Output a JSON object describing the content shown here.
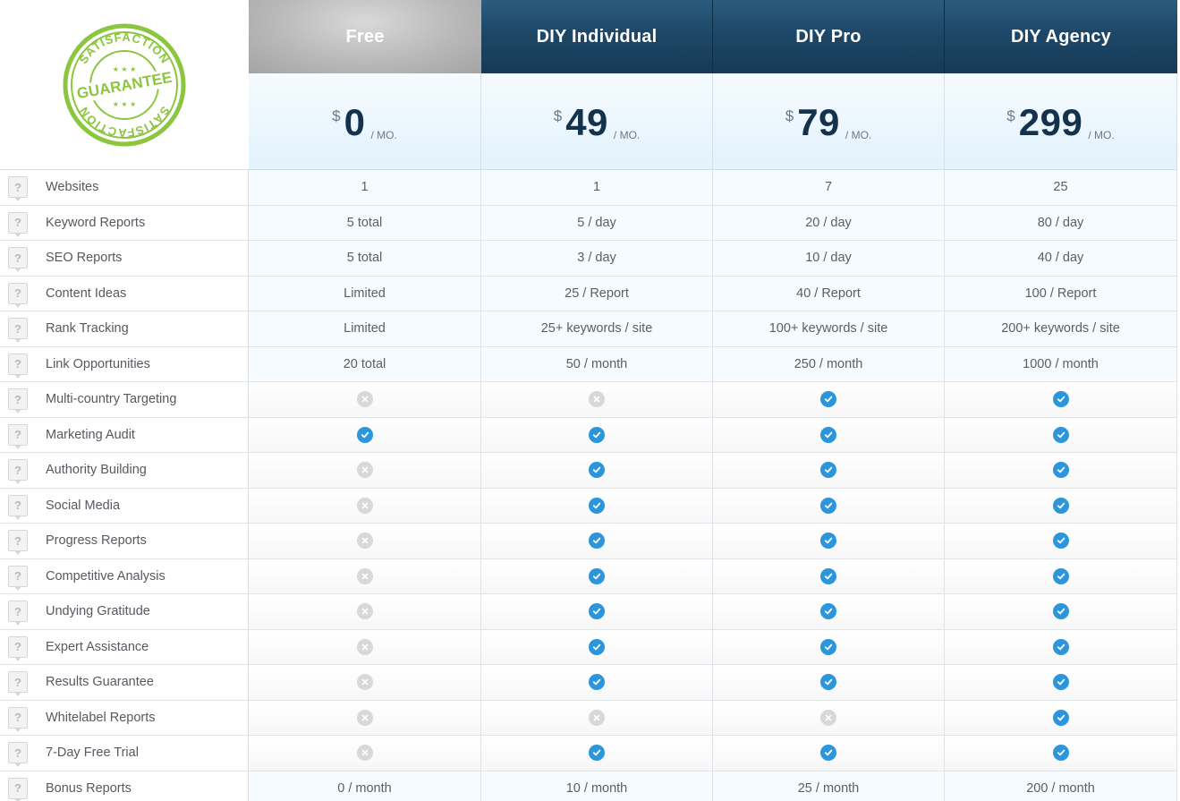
{
  "seal": {
    "top_text": "SATISFACTION",
    "middle_text": "GUARANTEE",
    "bottom_text": "SATISFACTION",
    "stars": "★ ★ ★",
    "color": "#8cc63f"
  },
  "plans": [
    {
      "name": "Free",
      "currency": "$",
      "amount": "0",
      "per": "/ MO."
    },
    {
      "name": "DIY Individual",
      "currency": "$",
      "amount": "49",
      "per": "/ MO."
    },
    {
      "name": "DIY Pro",
      "currency": "$",
      "amount": "79",
      "per": "/ MO."
    },
    {
      "name": "DIY Agency",
      "currency": "$",
      "amount": "299",
      "per": "/ MO."
    }
  ],
  "help_glyph": "?",
  "features": [
    {
      "label": "Websites",
      "values": [
        "1",
        "1",
        "7",
        "25"
      ]
    },
    {
      "label": "Keyword Reports",
      "values": [
        "5 total",
        "5 / day",
        "20 / day",
        "80 / day"
      ]
    },
    {
      "label": "SEO Reports",
      "values": [
        "5 total",
        "3 / day",
        "10 / day",
        "40 / day"
      ]
    },
    {
      "label": "Content Ideas",
      "values": [
        "Limited",
        "25 / Report",
        "40 / Report",
        "100 / Report"
      ]
    },
    {
      "label": "Rank Tracking",
      "values": [
        "Limited",
        "25+ keywords / site",
        "100+ keywords / site",
        "200+ keywords / site"
      ]
    },
    {
      "label": "Link Opportunities",
      "values": [
        "20 total",
        "50 / month",
        "250 / month",
        "1000 / month"
      ]
    },
    {
      "label": "Multi-country Targeting",
      "checks": [
        "no",
        "no",
        "yes",
        "yes"
      ]
    },
    {
      "label": "Marketing Audit",
      "checks": [
        "yes",
        "yes",
        "yes",
        "yes"
      ]
    },
    {
      "label": "Authority Building",
      "checks": [
        "no",
        "yes",
        "yes",
        "yes"
      ]
    },
    {
      "label": "Social Media",
      "checks": [
        "no",
        "yes",
        "yes",
        "yes"
      ]
    },
    {
      "label": "Progress Reports",
      "checks": [
        "no",
        "yes",
        "yes",
        "yes"
      ]
    },
    {
      "label": "Competitive Analysis",
      "checks": [
        "no",
        "yes",
        "yes",
        "yes"
      ]
    },
    {
      "label": "Undying Gratitude",
      "checks": [
        "no",
        "yes",
        "yes",
        "yes"
      ]
    },
    {
      "label": "Expert Assistance",
      "checks": [
        "no",
        "yes",
        "yes",
        "yes"
      ]
    },
    {
      "label": "Results Guarantee",
      "checks": [
        "no",
        "yes",
        "yes",
        "yes"
      ]
    },
    {
      "label": "Whitelabel Reports",
      "checks": [
        "no",
        "no",
        "no",
        "yes"
      ]
    },
    {
      "label": "7-Day Free Trial",
      "checks": [
        "no",
        "yes",
        "yes",
        "yes"
      ]
    },
    {
      "label": "Bonus Reports",
      "values": [
        "0 / month",
        "10 / month",
        "25 / month",
        "200 / month"
      ]
    }
  ],
  "colors": {
    "check_yes": "#2c96dc",
    "check_no": "#d8d8d8",
    "header_dark": "#1e4767",
    "header_free": "#b9b9b9",
    "price_bg": "#e3f2fc"
  }
}
